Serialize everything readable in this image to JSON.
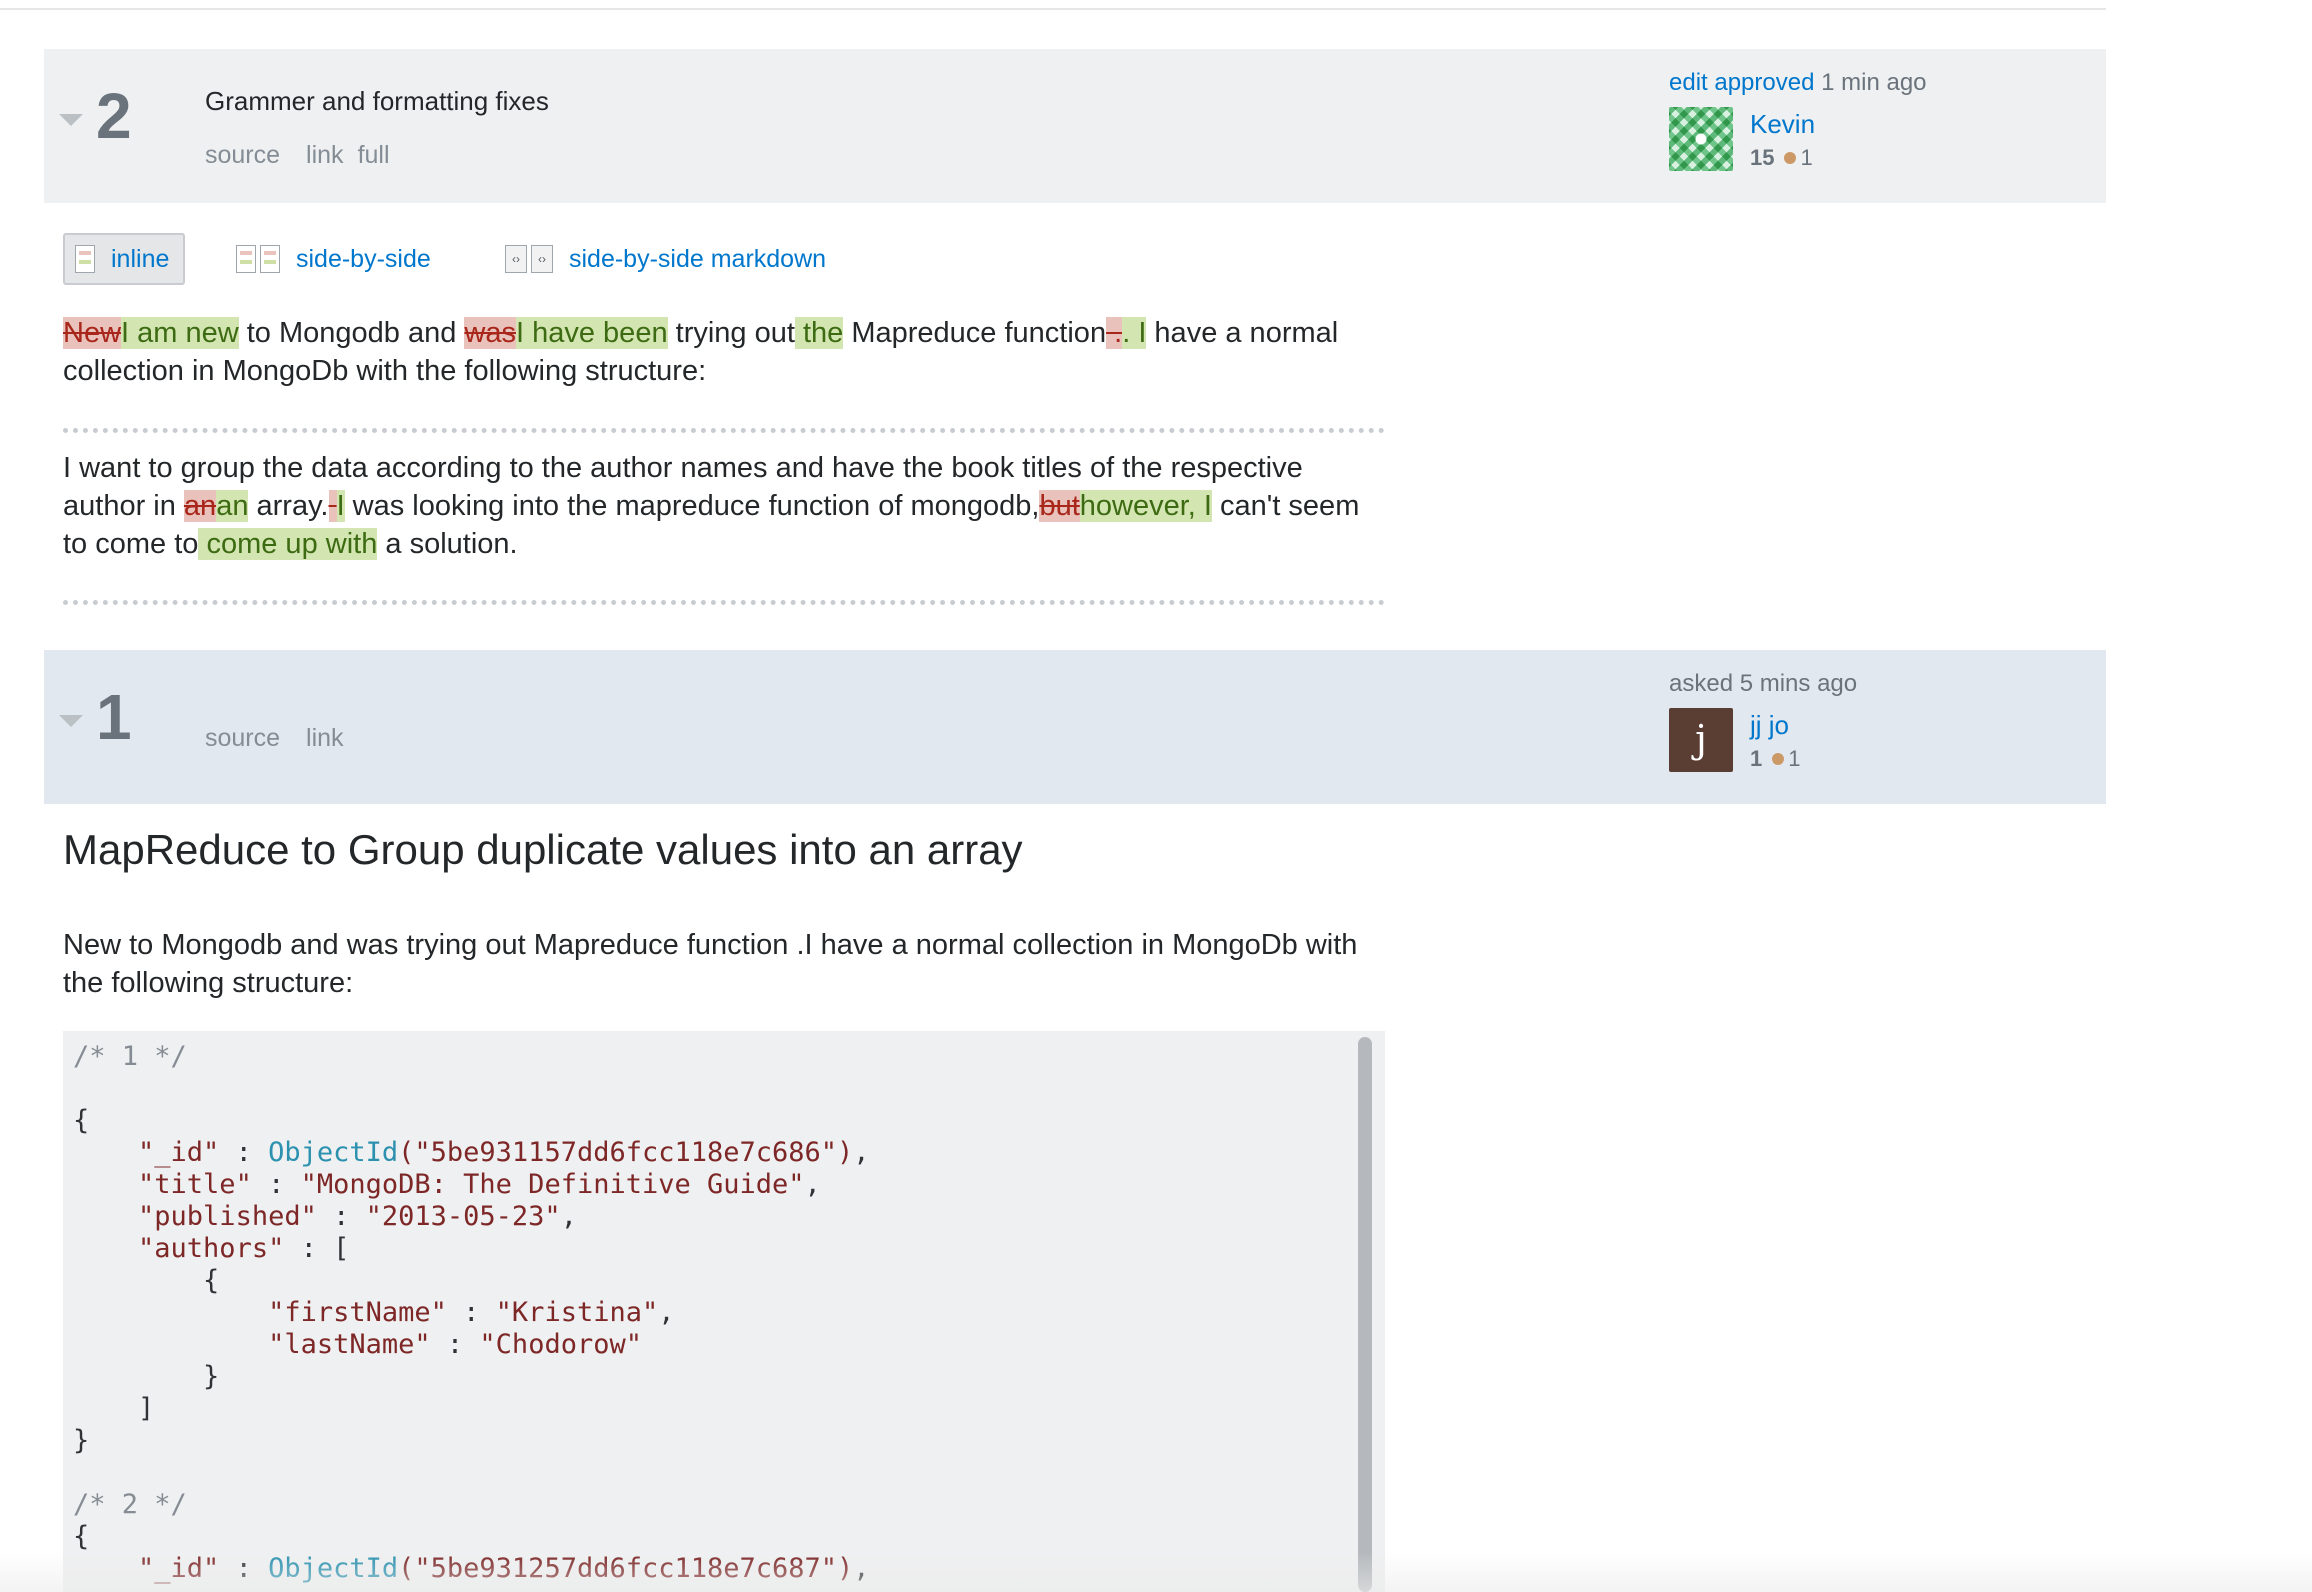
{
  "revision2": {
    "number": "2",
    "comment": "Grammer and formatting fixes",
    "links": [
      "source",
      "link",
      "full"
    ],
    "action_link": "edit approved",
    "action_time": "1 min ago",
    "user": {
      "name": "Kevin",
      "rep": "15",
      "bronze": "1"
    }
  },
  "view_toggles": [
    {
      "label": "inline",
      "active": true
    },
    {
      "label": "side-by-side",
      "active": false
    },
    {
      "label": "side-by-side markdown",
      "active": false
    }
  ],
  "diff": {
    "p1": {
      "d1": "New",
      "i1": "I am new",
      "t1": " to Mongodb and ",
      "d2": "was",
      "i2": "I have been",
      "t2": " trying out",
      "i3": " the",
      "t3": " Mapreduce function",
      "d4": " .",
      "i4": ". I",
      "t4": " have a normal collection in MongoDb with the following structure:"
    },
    "p2": {
      "t1": "I want to group the data according to the author names and have the book titles of the respective author in ",
      "d1": "an",
      "i1": "an",
      "t2": " array.",
      "d2": " ",
      "i2": " I",
      "t3": " was looking into the mapreduce function of mongodb,",
      "d3": "but",
      "i3": "however, I",
      "t4": " can't seem to come to",
      "i4": " come up with",
      "t5": " a solution."
    }
  },
  "revision1": {
    "number": "1",
    "links": [
      "source",
      "link"
    ],
    "action": "asked",
    "action_time": "5 mins ago",
    "user": {
      "name": "jj jo",
      "avatar_letter": "j",
      "rep": "1",
      "bronze": "1"
    }
  },
  "question": {
    "title": "MapReduce to Group duplicate values into an array",
    "body": "New to Mongodb and was trying out Mapreduce function .I have a normal collection in MongoDb with the following structure:"
  },
  "code": {
    "c1": "/* 1 */",
    "id_key": "\"_id\"",
    "fn": "ObjectId",
    "id1": "(\"5be931157dd6fcc118e7c686\")",
    "title_key": "\"title\"",
    "title1": "\"MongoDB: The Definitive Guide\"",
    "pub_key": "\"published\"",
    "pub1": "\"2013-05-23\"",
    "authors_key": "\"authors\"",
    "first_key": "\"firstName\"",
    "first1": "\"Kristina\"",
    "last_key": "\"lastName\"",
    "last1": "\"Chodorow\"",
    "c2": "/* 2 */",
    "id2": "(\"5be931257dd6fcc118e7c687\")"
  },
  "colors": {
    "link": "#0077cc",
    "deleted_bg": "#e8c2bb",
    "inserted_bg": "#d3e5b0",
    "header_gray": "#eff0f1",
    "header_blue": "#e1e8ef"
  }
}
